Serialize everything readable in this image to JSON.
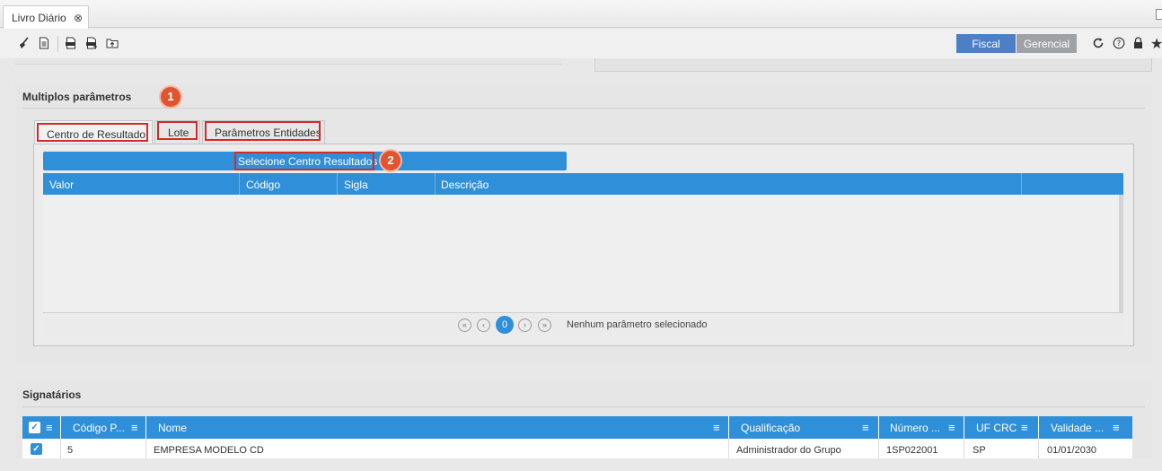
{
  "tab": {
    "title": "Livro Diário",
    "close_glyph": "⊗"
  },
  "toolbar": {
    "icons": [
      "broom-icon",
      "document-icon",
      "pdf-icon",
      "pdf-export-icon",
      "folder-upload-icon"
    ],
    "modes": {
      "fiscal": "Fiscal",
      "gerencial": "Gerencial",
      "active": "Fiscal"
    },
    "right_icons": [
      "refresh-icon",
      "help-icon",
      "lock-icon",
      "star-icon"
    ]
  },
  "params_panel": {
    "title": "Multiplos parâmetros",
    "badge1": "1",
    "badge2": "2",
    "tabs": [
      "Centro de Resultado",
      "Lote",
      "Parâmetros Entidades"
    ],
    "active_tab": "Centro de Resultado",
    "select_button": "Selecione Centro Resultados",
    "columns": [
      "Valor",
      "Código",
      "Sigla",
      "Descrição"
    ],
    "pager": {
      "current_page": "0",
      "status": "Nenhum parâmetro selecionado"
    }
  },
  "signatarios": {
    "title": "Signatários",
    "columns": [
      "Código P...",
      "Nome",
      "Qualificação",
      "Número ...",
      "UF CRC",
      "Validade ..."
    ],
    "rows": [
      {
        "checked": true,
        "codigo": "5",
        "nome": "EMPRESA MODELO CD",
        "qualificacao": "Administrador do Grupo",
        "numero": "1SP022001",
        "uf": "SP",
        "validade": "01/01/2030"
      }
    ]
  },
  "colors": {
    "accent_blue": "#2f8fd8",
    "fiscal_blue": "#4d7fc4",
    "highlight_red": "#d42a2a",
    "badge_orange": "#e0552f"
  }
}
